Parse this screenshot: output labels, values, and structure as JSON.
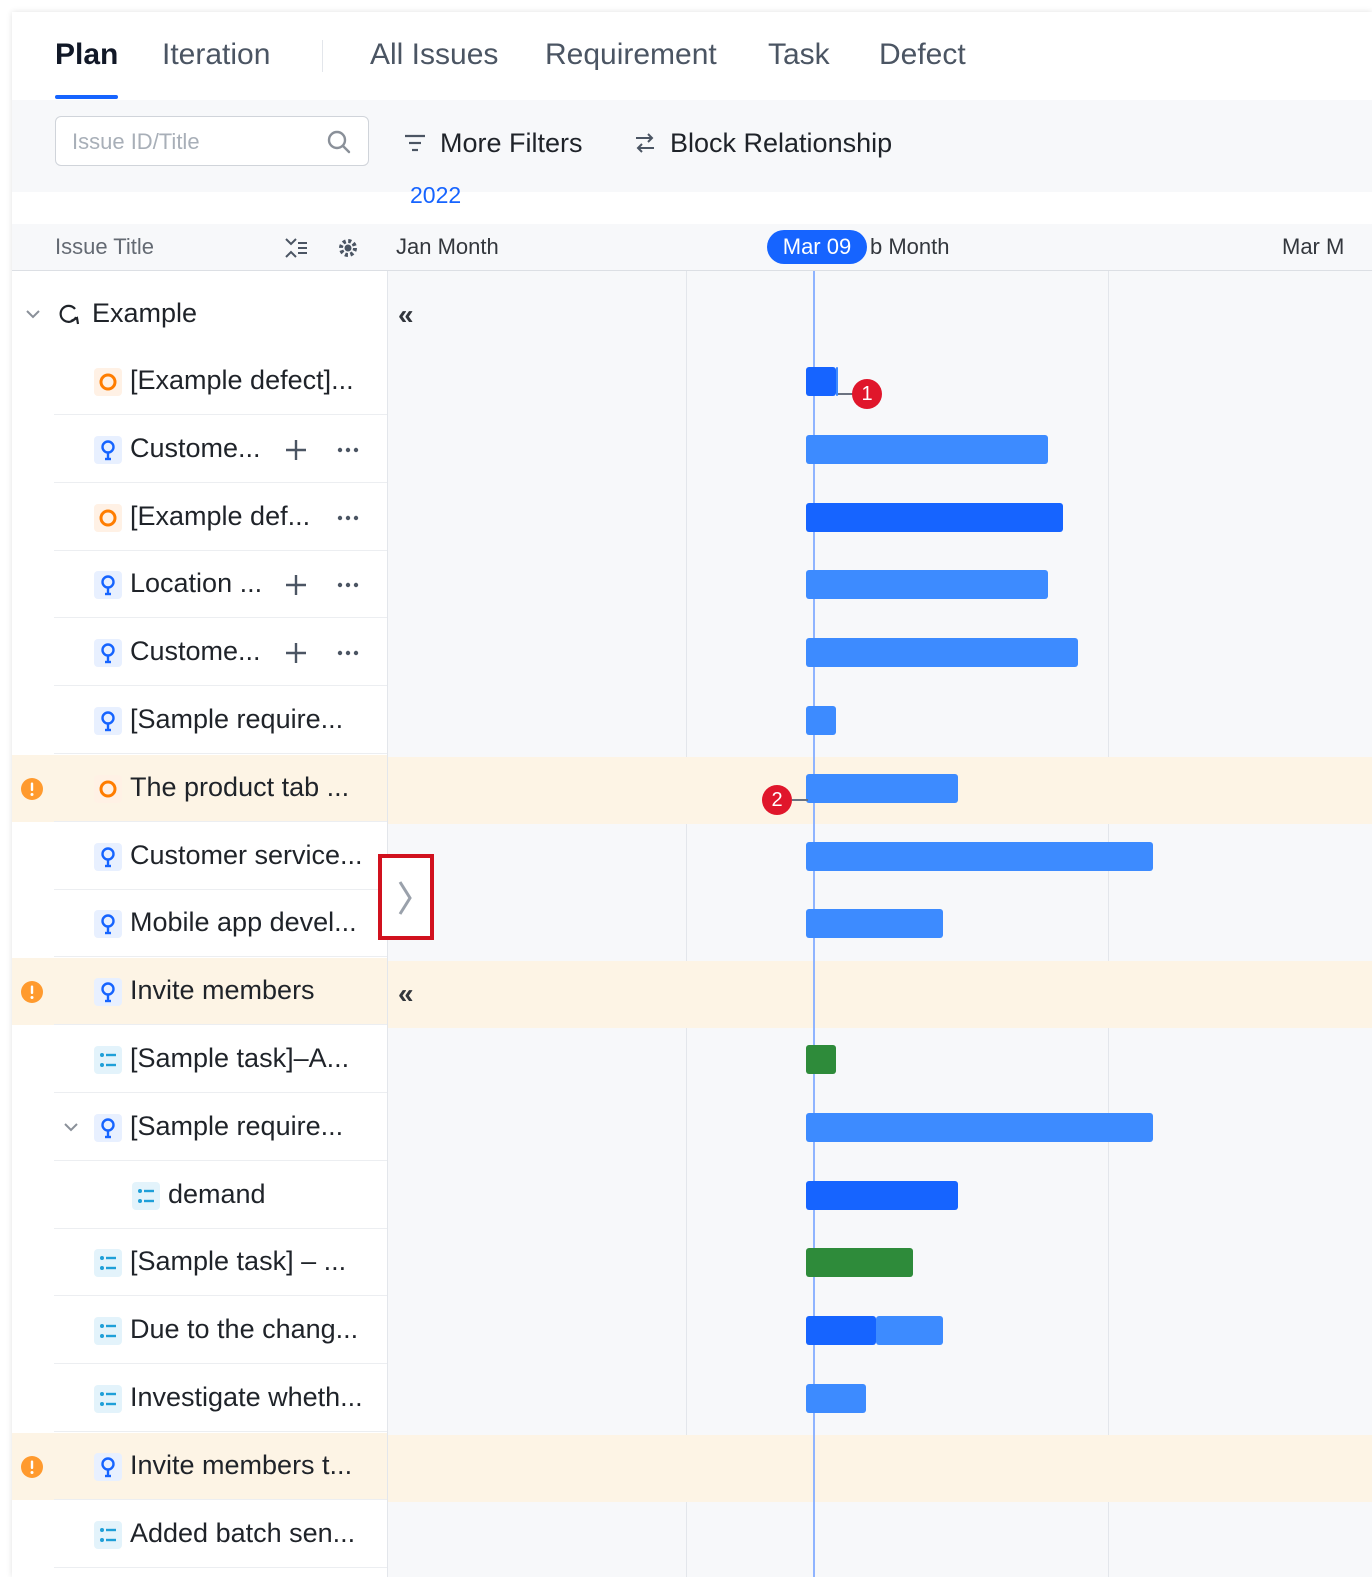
{
  "tabs": [
    {
      "label": "Plan",
      "active": true
    },
    {
      "label": "Iteration"
    },
    {
      "label": "All Issues"
    },
    {
      "label": "Requirement"
    },
    {
      "label": "Task"
    },
    {
      "label": "Defect"
    }
  ],
  "toolbar": {
    "search_placeholder": "Issue ID/Title",
    "more_filters": "More Filters",
    "block_relationship": "Block Relationship"
  },
  "timeline": {
    "year": "2022",
    "today_label": "Mar 09",
    "months": [
      "Jan Month",
      "b Month",
      "Mar M"
    ]
  },
  "header": {
    "issue_title": "Issue Title"
  },
  "group": {
    "label": "Example",
    "collapse_mark": "«"
  },
  "rows": [
    {
      "title": "[Example defect]...",
      "type": "defect"
    },
    {
      "title": "Custome...",
      "type": "requirement"
    },
    {
      "title": "[Example def...",
      "type": "defect"
    },
    {
      "title": "Location ...",
      "type": "requirement"
    },
    {
      "title": "Custome...",
      "type": "requirement"
    },
    {
      "title": "[Sample require...",
      "type": "requirement"
    },
    {
      "title": "The product tab ...",
      "type": "defect",
      "warning": true
    },
    {
      "title": "Customer service...",
      "type": "requirement"
    },
    {
      "title": "Mobile app devel...",
      "type": "requirement"
    },
    {
      "title": "Invite members",
      "type": "requirement",
      "warning": true
    },
    {
      "title": "[Sample task]–A...",
      "type": "task"
    },
    {
      "title": "[Sample require...",
      "type": "requirement",
      "expanded": true
    },
    {
      "title": "demand",
      "type": "task",
      "child": true
    },
    {
      "title": "[Sample task] – ...",
      "type": "task"
    },
    {
      "title": "Due to the chang...",
      "type": "task"
    },
    {
      "title": "Investigate wheth...",
      "type": "task"
    },
    {
      "title": "Invite members t...",
      "type": "requirement",
      "warning": true
    },
    {
      "title": "Added batch sen...",
      "type": "task"
    }
  ],
  "dependency_badges": [
    "1",
    "2"
  ],
  "colors": {
    "accent": "#1664ff",
    "requirement_bar": "#3d8bff",
    "defect_icon": "#ff7d00",
    "task_bar": "#2e8b3a",
    "warning_bg": "#fdf4e5",
    "badge": "#e0162b"
  }
}
